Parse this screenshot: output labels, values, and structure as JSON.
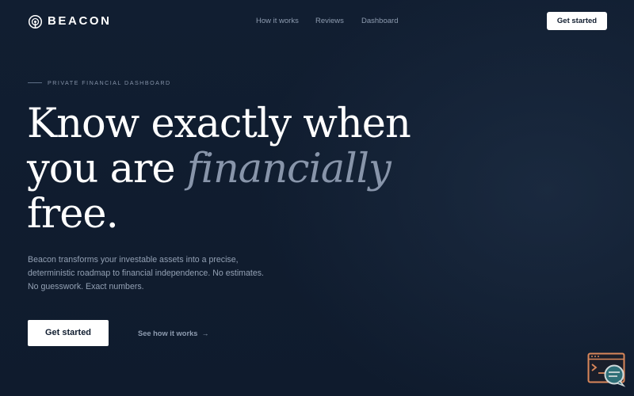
{
  "brand": {
    "name": "BEACON",
    "logo_icon": "beacon-ring-icon"
  },
  "nav": {
    "links": [
      "How it works",
      "Reviews",
      "Dashboard"
    ],
    "cta_label": "Get started"
  },
  "hero": {
    "eyebrow": "PRIVATE FINANCIAL DASHBOARD",
    "headline": {
      "line1": "Know exactly when",
      "line2_plain": "you are ",
      "line2_accent": "financially",
      "line3": "free."
    },
    "subcopy": [
      "Beacon transforms your investable assets into a precise,",
      "deterministic roadmap to financial independence. No estimates.",
      "No guesswork. Exact numbers."
    ],
    "primary_cta": "Get started",
    "secondary_cta": {
      "label": "See how it works",
      "icon": "arrow-right-icon"
    }
  },
  "floating_widget": {
    "icon": "terminal-chat-icon"
  },
  "colors": {
    "background": "#0f1c2e",
    "text": "#ffffff",
    "muted": "#8e9cb0",
    "accent_italic": "#8895aa",
    "widget_orange": "#d9875a",
    "widget_teal": "#2f6f78"
  }
}
